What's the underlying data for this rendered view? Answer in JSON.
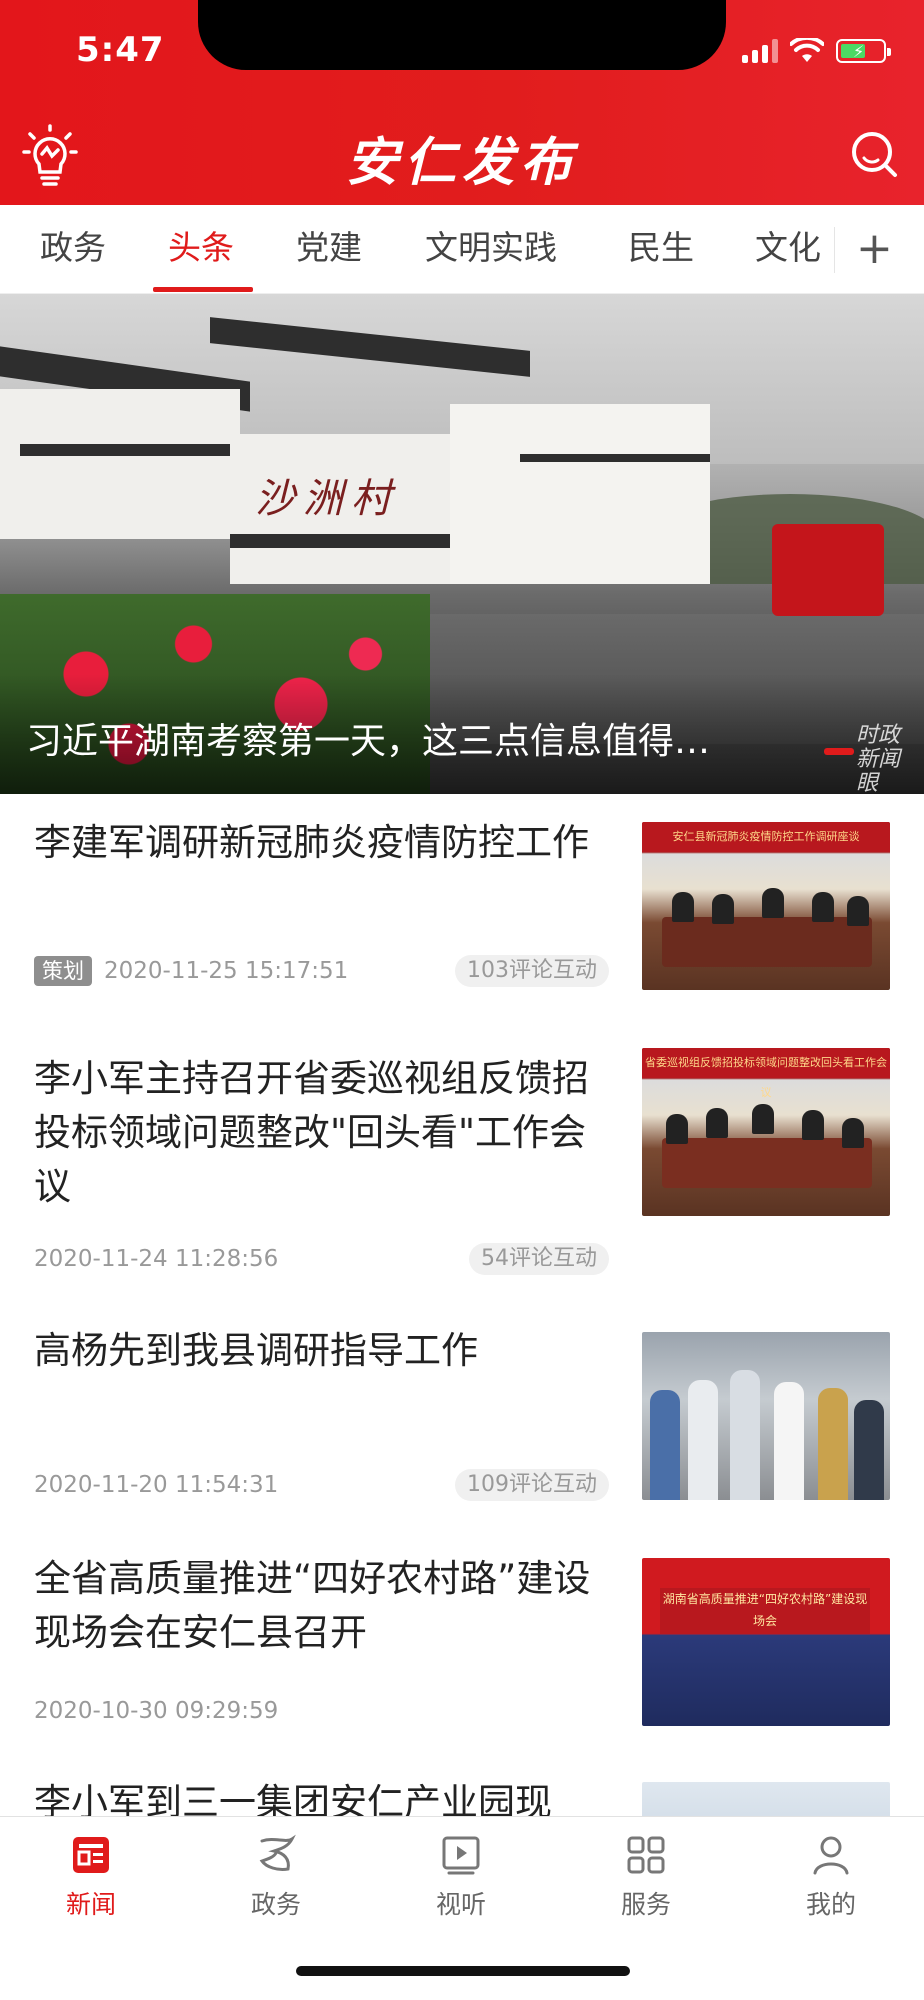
{
  "status_bar": {
    "time": "5:47"
  },
  "header": {
    "title": "安仁发布"
  },
  "tabs": {
    "items": [
      {
        "label": "政务",
        "active": false
      },
      {
        "label": "头条",
        "active": true
      },
      {
        "label": "党建",
        "active": false
      },
      {
        "label": "文明实践",
        "active": false
      },
      {
        "label": "民生",
        "active": false
      },
      {
        "label": "文化",
        "active": false
      }
    ],
    "add_label": "+"
  },
  "hero": {
    "title": "习近平湖南考察第一天，这三点信息值得…",
    "watermark": "时政新闻眼"
  },
  "news": [
    {
      "title": "李建军调研新冠肺炎疫情防控工作",
      "badge": "策划",
      "date": "2020-11-25 15:17:51",
      "comments": "103评论互动",
      "thumb_text": "安仁县新冠肺炎疫情防控工作调研座谈"
    },
    {
      "title": "李小军主持召开省委巡视组反馈招投标领域问题整改\"回头看\"工作会议",
      "date": "2020-11-24 11:28:56",
      "comments": "54评论互动",
      "thumb_text": "省委巡视组反馈招投标领域问题整改回头看工作会议"
    },
    {
      "title": "高杨先到我县调研指导工作",
      "date": "2020-11-20 11:54:31",
      "comments": "109评论互动"
    },
    {
      "title": "全省高质量推进“四好农村路”建设现场会在安仁县召开",
      "date": "2020-10-30 09:29:59",
      "thumb_text": "湖南省高质量推进“四好农村路”建设现场会"
    },
    {
      "title": "李小军到三一集团安仁产业园现"
    }
  ],
  "tabbar": {
    "items": [
      {
        "label": "新闻",
        "icon": "news-icon",
        "active": true
      },
      {
        "label": "政务",
        "icon": "government-icon",
        "active": false
      },
      {
        "label": "视听",
        "icon": "video-icon",
        "active": false
      },
      {
        "label": "服务",
        "icon": "grid-icon",
        "active": false
      },
      {
        "label": "我的",
        "icon": "user-icon",
        "active": false
      }
    ]
  },
  "colors": {
    "accent": "#e01b1b",
    "header": "#e3161b",
    "text": "#222222",
    "meta": "#999999"
  }
}
